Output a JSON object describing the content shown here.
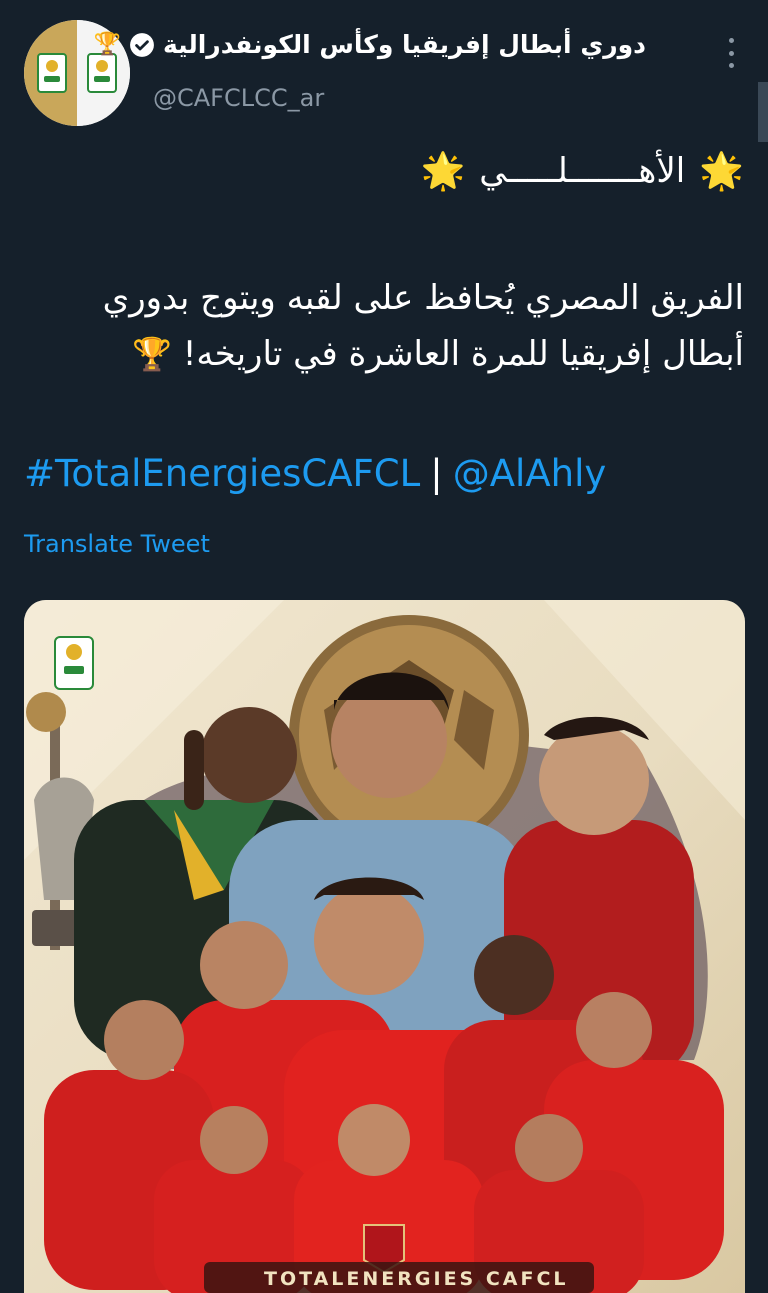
{
  "tweet": {
    "display_name": "دوري أبطال إفريقيا وكأس الكونفدرالية",
    "handle": "@CAFCLCC_ar",
    "title": "الأهـــــــلـــــي",
    "body_line1": "الفريق المصري يُحافظ على لقبه ويتوج بدوري",
    "body_line2": "أبطال إفريقيا للمرة العاشرة في تاريخه!",
    "hashtag": "#TotalEnergiesCAFCL",
    "separator": "|",
    "mention": "@AlAhly",
    "translate_label": "Translate Tweet",
    "trophy_emoji": "🏆",
    "star_emoji": "🌟"
  },
  "media": {
    "caption": "TOTALENERGIES CAFCL",
    "logo_text": "CAF"
  },
  "icons": {
    "verified": "verified-badge-icon",
    "more": "more-options-icon",
    "trophy": "trophy-icon",
    "star": "star-icon"
  },
  "colors": {
    "background": "#15202b",
    "link": "#1d9bf0",
    "secondary_text": "#8b98a5",
    "jersey_red": "#d8201f",
    "poster_bg": "#efe4cb"
  }
}
